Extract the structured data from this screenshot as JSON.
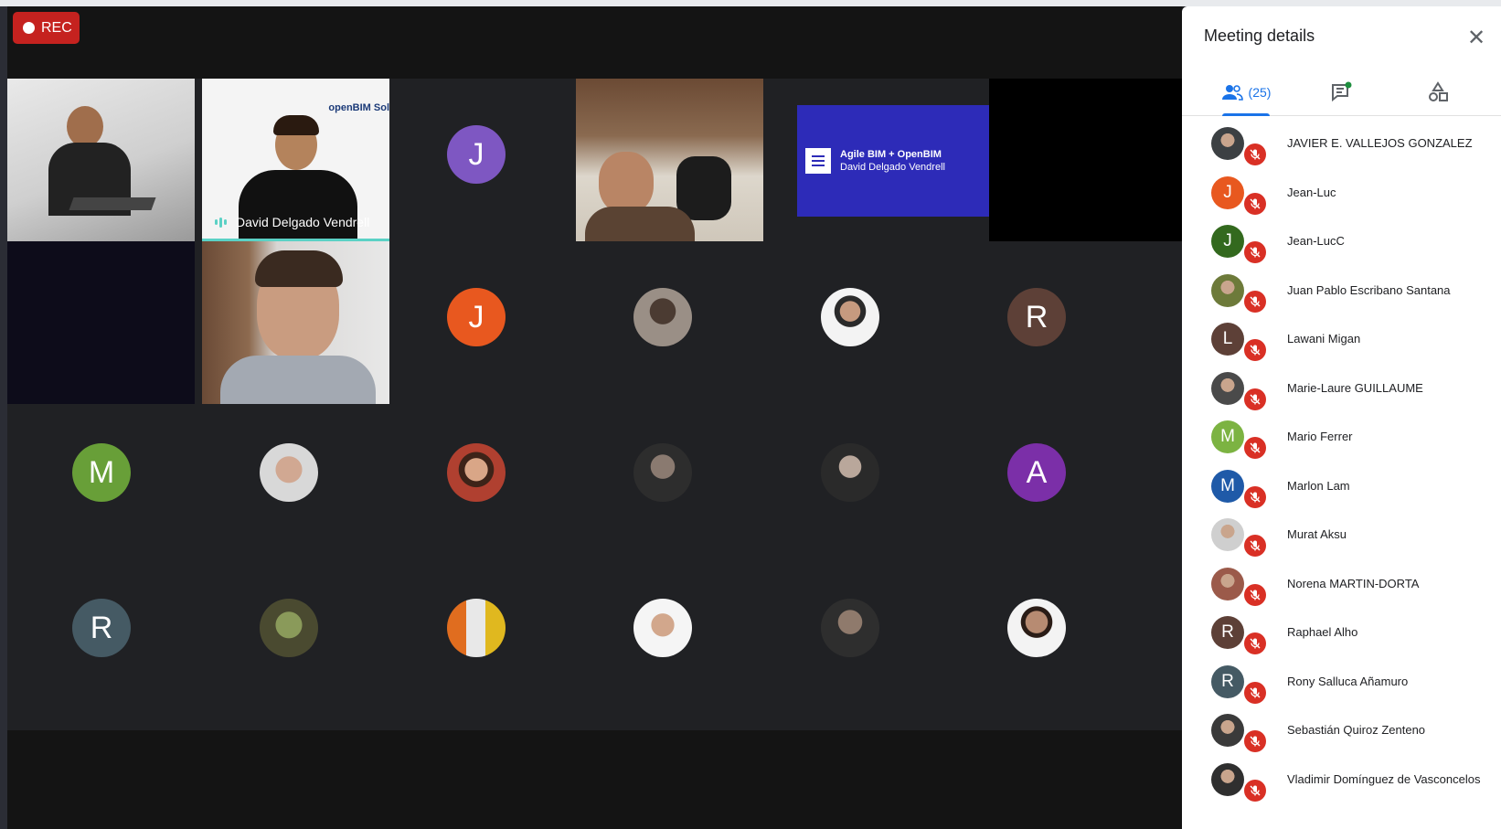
{
  "recording": {
    "label": "REC"
  },
  "presenting": {
    "title": "Agile BIM + OpenBIM",
    "presenter": "David Delgado Vendrell"
  },
  "speaker_tile": {
    "name": "David Delgado Vendrell",
    "slide_text": "openBIM Sol"
  },
  "grid": {
    "letter_avatars": [
      {
        "letter": "J",
        "color": "#7e57c2"
      },
      {
        "letter": "J",
        "color": "#e8581f"
      },
      {
        "letter": "R",
        "color": "#5d4037"
      },
      {
        "letter": "M",
        "color": "#689f38"
      },
      {
        "letter": "A",
        "color": "#7b2fa8"
      },
      {
        "letter": "R",
        "color": "#455a64"
      }
    ]
  },
  "panel": {
    "title": "Meeting details",
    "people_count": "(25)",
    "participants": [
      {
        "name": "JAVIER E. VALLEJOS GONZALEZ",
        "initial": "",
        "color": "#3c4043"
      },
      {
        "name": "Jean-Luc",
        "initial": "J",
        "color": "#e8581f"
      },
      {
        "name": "Jean-LucC",
        "initial": "J",
        "color": "#33691e"
      },
      {
        "name": "Juan Pablo Escribano Santana",
        "initial": "",
        "color": "#6d7a3a"
      },
      {
        "name": "Lawani Migan",
        "initial": "L",
        "color": "#5d4037"
      },
      {
        "name": "Marie-Laure GUILLAUME",
        "initial": "",
        "color": "#4a4a4a"
      },
      {
        "name": "Mario Ferrer",
        "initial": "M",
        "color": "#7cb342"
      },
      {
        "name": "Marlon Lam",
        "initial": "M",
        "color": "#1f5aa8"
      },
      {
        "name": "Murat Aksu",
        "initial": "",
        "color": "#cfcfcf"
      },
      {
        "name": "Norena MARTIN-DORTA",
        "initial": "",
        "color": "#9b5a4a"
      },
      {
        "name": "Raphael Alho",
        "initial": "R",
        "color": "#5d4037"
      },
      {
        "name": "Rony Salluca Añamuro",
        "initial": "R",
        "color": "#455a64"
      },
      {
        "name": "Sebastián Quiroz Zenteno",
        "initial": "",
        "color": "#3a3a3a"
      },
      {
        "name": "Vladimir Domínguez de Vasconcelos",
        "initial": "",
        "color": "#2f2f2f"
      }
    ]
  }
}
